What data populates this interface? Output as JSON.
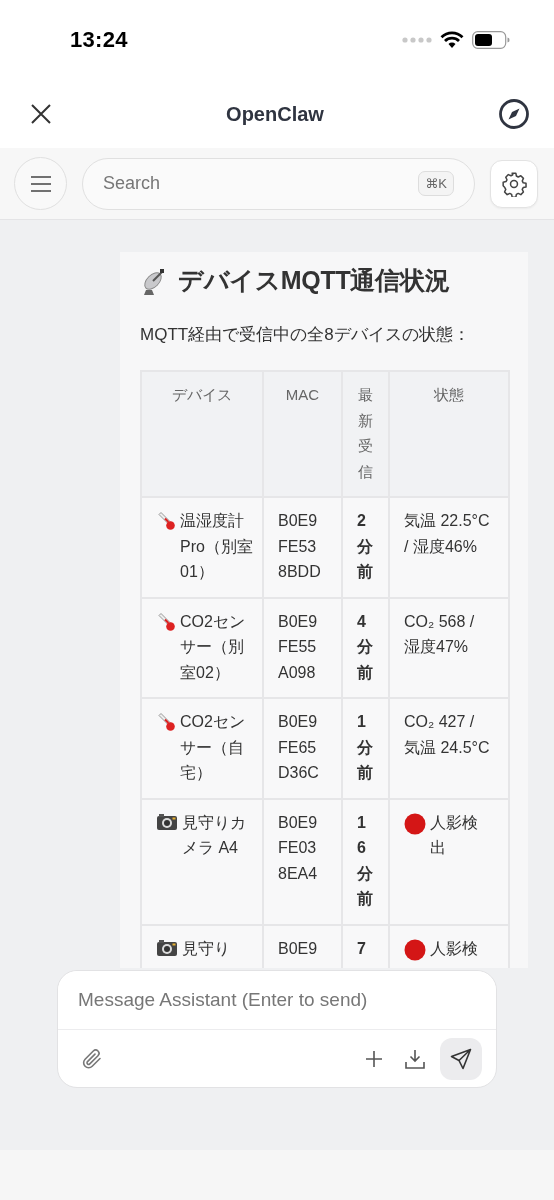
{
  "status_bar": {
    "time": "13:24"
  },
  "header": {
    "title": "OpenClaw"
  },
  "toolbar": {
    "search": {
      "placeholder": "Search",
      "shortcut": "⌘K"
    }
  },
  "message": {
    "title": "デバイスMQTT通信状況",
    "intro": "MQTT経由で受信中の全8デバイスの状態：",
    "table": {
      "columns": [
        "デバイス",
        "MAC",
        "最新受信",
        "状態"
      ],
      "rows": [
        {
          "kind": "thermometer",
          "device": "温湿度計Pro（別室01）",
          "mac": "B0E9FE538BDD",
          "last": "2分前",
          "status": "気温 22.5°C / 湿度46%",
          "alert": false
        },
        {
          "kind": "thermometer",
          "device": "CO2センサー（別室02）",
          "mac": "B0E9FE55A098",
          "last": "4分前",
          "status": "CO₂ 568 / 湿度47%",
          "alert": false
        },
        {
          "kind": "thermometer",
          "device": "CO2センサー（自宅）",
          "mac": "B0E9FE65D36C",
          "last": "1分前",
          "status": "CO₂ 427 / 気温 24.5°C",
          "alert": false
        },
        {
          "kind": "camera",
          "device": "見守りカメラ A4",
          "mac": "B0E9FE038EA4",
          "last": "16分前",
          "status": "人影検出",
          "alert": true
        },
        {
          "kind": "camera",
          "device": "見守り",
          "mac": "B0E9",
          "last": "7",
          "status": "人影検",
          "alert": true
        }
      ]
    }
  },
  "composer": {
    "placeholder": "Message Assistant (Enter to send)"
  }
}
